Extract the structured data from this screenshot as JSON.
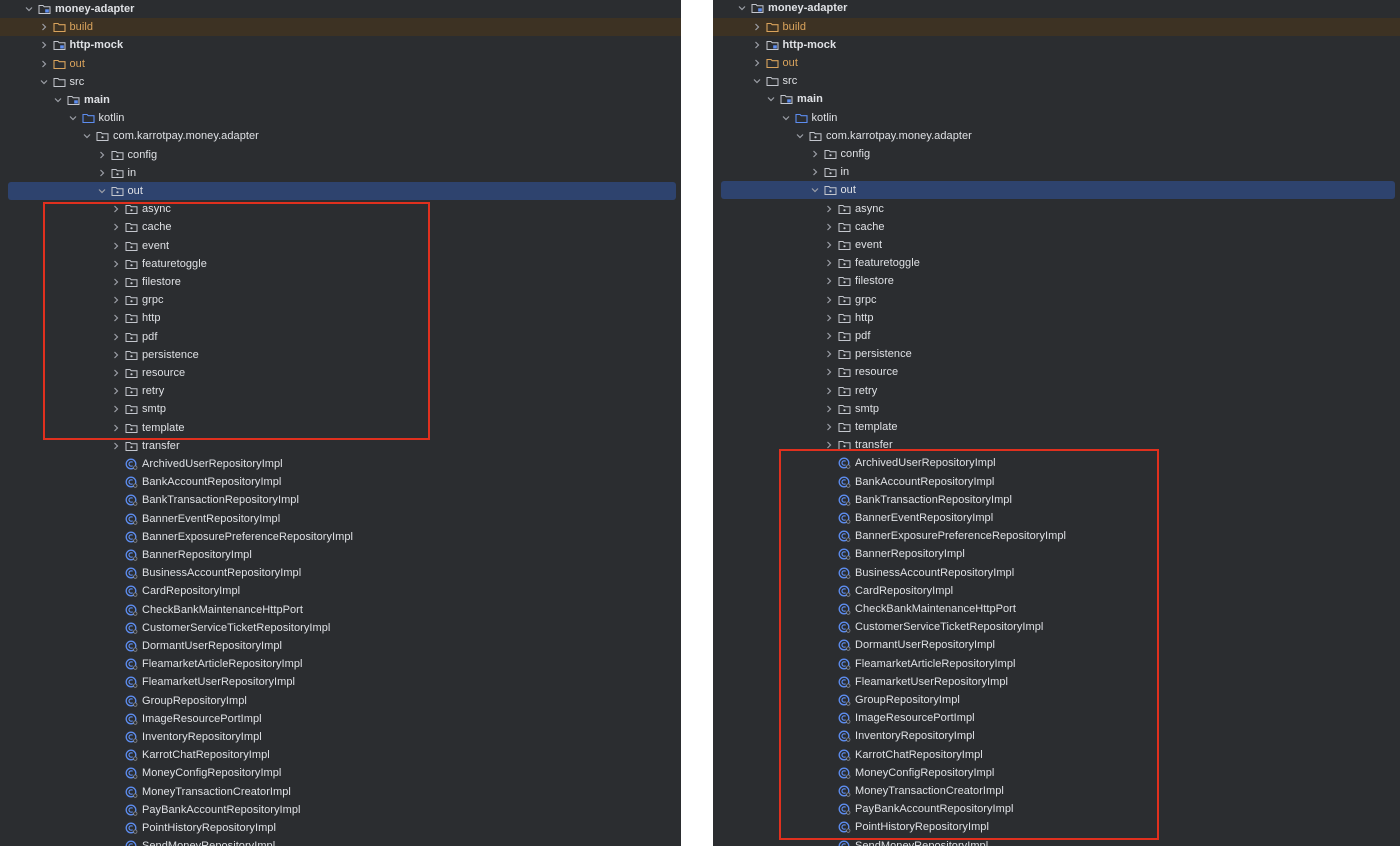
{
  "colors": {
    "panel_bg": "#2b2d30",
    "text": "#dfe1e5",
    "excluded_text": "#d9a35c",
    "selection": "#2e436e",
    "highlight_box": "#e0301e",
    "class_icon": "#5d8df0"
  },
  "tree": [
    {
      "label": "money-adapter",
      "depth": 0,
      "expanded": true,
      "icon": "module-folder-icon",
      "bold": true
    },
    {
      "label": "build",
      "depth": 1,
      "expanded": false,
      "icon": "excluded-folder-icon",
      "style": "excluded"
    },
    {
      "label": "http-mock",
      "depth": 1,
      "expanded": false,
      "icon": "module-folder-icon",
      "bold": true
    },
    {
      "label": "out",
      "depth": 1,
      "expanded": false,
      "icon": "excluded-folder-icon",
      "style": "orange"
    },
    {
      "label": "src",
      "depth": 1,
      "expanded": true,
      "icon": "folder-icon"
    },
    {
      "label": "main",
      "depth": 2,
      "expanded": true,
      "icon": "module-folder-icon",
      "bold": true
    },
    {
      "label": "kotlin",
      "depth": 3,
      "expanded": true,
      "icon": "source-folder-icon"
    },
    {
      "label": "com.karrotpay.money.adapter",
      "depth": 4,
      "expanded": true,
      "icon": "package-icon"
    },
    {
      "label": "config",
      "depth": 5,
      "expanded": false,
      "icon": "package-icon"
    },
    {
      "label": "in",
      "depth": 5,
      "expanded": false,
      "icon": "package-icon"
    },
    {
      "label": "out",
      "depth": 5,
      "expanded": true,
      "icon": "package-icon",
      "selected": true
    },
    {
      "label": "async",
      "depth": 6,
      "expanded": false,
      "icon": "package-icon"
    },
    {
      "label": "cache",
      "depth": 6,
      "expanded": false,
      "icon": "package-icon"
    },
    {
      "label": "event",
      "depth": 6,
      "expanded": false,
      "icon": "package-icon"
    },
    {
      "label": "featuretoggle",
      "depth": 6,
      "expanded": false,
      "icon": "package-icon"
    },
    {
      "label": "filestore",
      "depth": 6,
      "expanded": false,
      "icon": "package-icon"
    },
    {
      "label": "grpc",
      "depth": 6,
      "expanded": false,
      "icon": "package-icon"
    },
    {
      "label": "http",
      "depth": 6,
      "expanded": false,
      "icon": "package-icon"
    },
    {
      "label": "pdf",
      "depth": 6,
      "expanded": false,
      "icon": "package-icon"
    },
    {
      "label": "persistence",
      "depth": 6,
      "expanded": false,
      "icon": "package-icon"
    },
    {
      "label": "resource",
      "depth": 6,
      "expanded": false,
      "icon": "package-icon"
    },
    {
      "label": "retry",
      "depth": 6,
      "expanded": false,
      "icon": "package-icon"
    },
    {
      "label": "smtp",
      "depth": 6,
      "expanded": false,
      "icon": "package-icon"
    },
    {
      "label": "template",
      "depth": 6,
      "expanded": false,
      "icon": "package-icon"
    },
    {
      "label": "transfer",
      "depth": 6,
      "expanded": false,
      "icon": "package-icon"
    },
    {
      "label": "ArchivedUserRepositoryImpl",
      "depth": 6,
      "icon": "class-icon"
    },
    {
      "label": "BankAccountRepositoryImpl",
      "depth": 6,
      "icon": "class-icon"
    },
    {
      "label": "BankTransactionRepositoryImpl",
      "depth": 6,
      "icon": "class-icon"
    },
    {
      "label": "BannerEventRepositoryImpl",
      "depth": 6,
      "icon": "class-icon"
    },
    {
      "label": "BannerExposurePreferenceRepositoryImpl",
      "depth": 6,
      "icon": "class-icon"
    },
    {
      "label": "BannerRepositoryImpl",
      "depth": 6,
      "icon": "class-icon"
    },
    {
      "label": "BusinessAccountRepositoryImpl",
      "depth": 6,
      "icon": "class-icon"
    },
    {
      "label": "CardRepositoryImpl",
      "depth": 6,
      "icon": "class-icon"
    },
    {
      "label": "CheckBankMaintenanceHttpPort",
      "depth": 6,
      "icon": "class-icon"
    },
    {
      "label": "CustomerServiceTicketRepositoryImpl",
      "depth": 6,
      "icon": "class-icon"
    },
    {
      "label": "DormantUserRepositoryImpl",
      "depth": 6,
      "icon": "class-icon"
    },
    {
      "label": "FleamarketArticleRepositoryImpl",
      "depth": 6,
      "icon": "class-icon"
    },
    {
      "label": "FleamarketUserRepositoryImpl",
      "depth": 6,
      "icon": "class-icon"
    },
    {
      "label": "GroupRepositoryImpl",
      "depth": 6,
      "icon": "class-icon"
    },
    {
      "label": "ImageResourcePortImpl",
      "depth": 6,
      "icon": "class-icon"
    },
    {
      "label": "InventoryRepositoryImpl",
      "depth": 6,
      "icon": "class-icon"
    },
    {
      "label": "KarrotChatRepositoryImpl",
      "depth": 6,
      "icon": "class-icon"
    },
    {
      "label": "MoneyConfigRepositoryImpl",
      "depth": 6,
      "icon": "class-icon"
    },
    {
      "label": "MoneyTransactionCreatorImpl",
      "depth": 6,
      "icon": "class-icon"
    },
    {
      "label": "PayBankAccountRepositoryImpl",
      "depth": 6,
      "icon": "class-icon"
    },
    {
      "label": "PointHistoryRepositoryImpl",
      "depth": 6,
      "icon": "class-icon"
    },
    {
      "label": "SendMoneyRepositoryImpl",
      "depth": 6,
      "icon": "class-icon"
    }
  ]
}
